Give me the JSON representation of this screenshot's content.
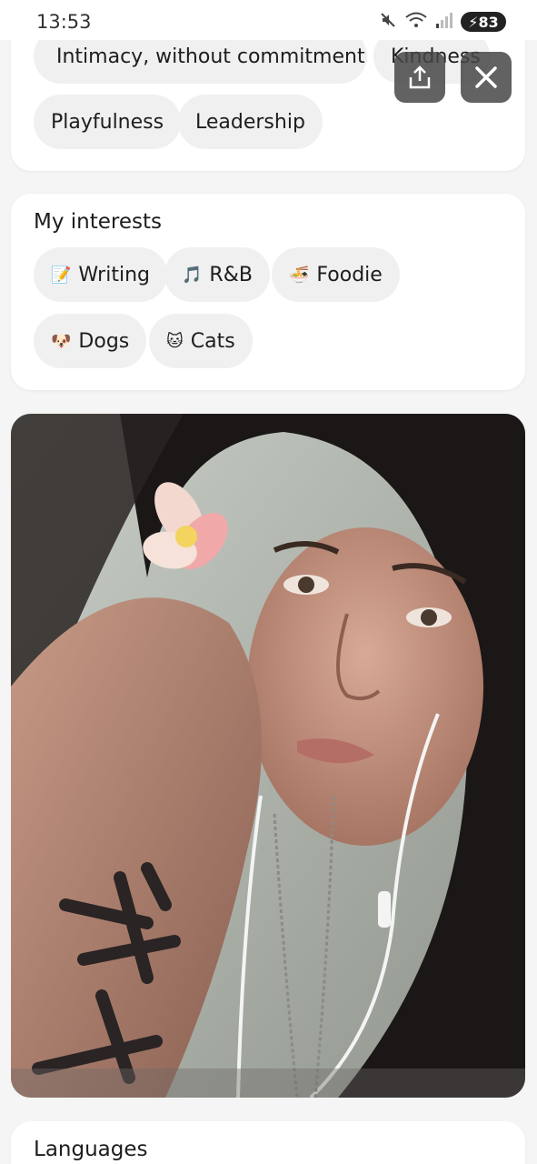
{
  "status_bar": {
    "time": "13:53",
    "battery": "83",
    "icons": [
      "mute-icon",
      "wifi-icon",
      "signal-icon",
      "battery-icon"
    ]
  },
  "looking_for": {
    "chips": [
      "Intimacy, without commitment",
      "Kindness",
      "Playfulness",
      "Leadership"
    ]
  },
  "interests": {
    "title": "My interests",
    "chips": [
      {
        "emoji": "📝",
        "label": "Writing"
      },
      {
        "emoji": "🎵",
        "label": "R&B"
      },
      {
        "emoji": "🍜",
        "label": "Foodie"
      },
      {
        "emoji": "🐶",
        "label": "Dogs"
      },
      {
        "emoji": "🐱",
        "label": "Cats"
      }
    ]
  },
  "actions": {
    "share": "share-icon",
    "close": "close-icon"
  },
  "photo": {
    "subject": "profile-photo"
  },
  "languages": {
    "title": "Languages"
  }
}
